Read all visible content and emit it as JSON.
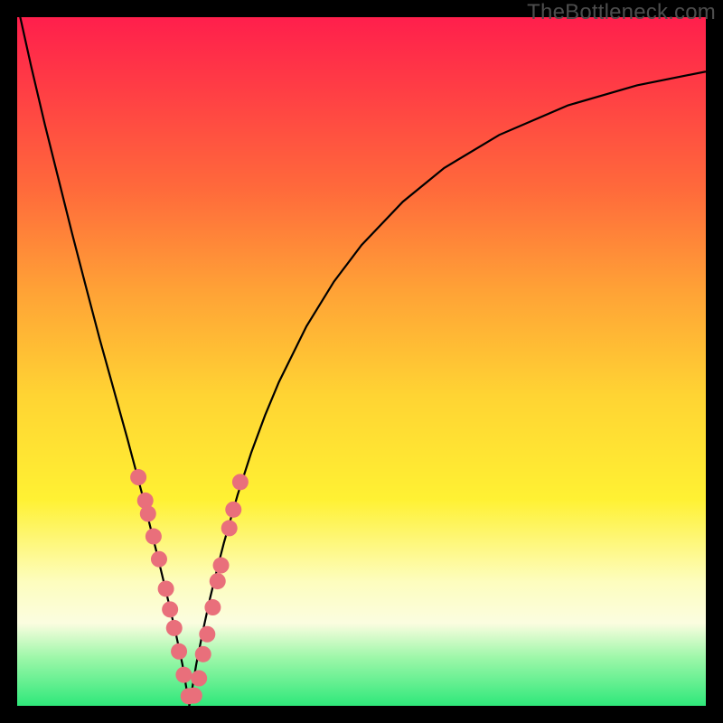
{
  "watermark": "TheBottleneck.com",
  "chart_data": {
    "type": "line",
    "title": "",
    "xlabel": "",
    "ylabel": "",
    "xlim": [
      0,
      100
    ],
    "ylim": [
      0,
      100
    ],
    "minimum_x": 25,
    "series": [
      {
        "name": "curve",
        "x": [
          0,
          2,
          4,
          6,
          8,
          10,
          12,
          14,
          16,
          18,
          20,
          21,
          22,
          23,
          24,
          25,
          26,
          27,
          28,
          29,
          30,
          32,
          34,
          36,
          38,
          42,
          46,
          50,
          56,
          62,
          70,
          80,
          90,
          100
        ],
        "y": [
          102,
          93,
          84.5,
          76.5,
          68.5,
          60.8,
          53.2,
          46,
          38.8,
          31.3,
          23.3,
          19.2,
          15,
          10.7,
          6,
          0,
          6,
          11,
          15.6,
          19.7,
          23.6,
          30.6,
          36.8,
          42.2,
          47,
          55.1,
          61.6,
          66.9,
          73.2,
          78.1,
          82.9,
          87.2,
          90.1,
          92.1
        ]
      }
    ],
    "markers": {
      "name": "cluster",
      "x": [
        17.6,
        18.6,
        19.0,
        19.8,
        20.6,
        21.6,
        22.2,
        22.8,
        23.5,
        24.2,
        24.9,
        25.7,
        26.4,
        27.0,
        27.6,
        28.4,
        29.1,
        29.6,
        30.8,
        31.4,
        32.4
      ],
      "y": [
        33.2,
        29.8,
        27.9,
        24.6,
        21.3,
        17.0,
        14.0,
        11.3,
        7.9,
        4.5,
        1.4,
        1.5,
        4.0,
        7.5,
        10.4,
        14.3,
        18.1,
        20.4,
        25.8,
        28.5,
        32.5
      ],
      "r": 9
    }
  }
}
